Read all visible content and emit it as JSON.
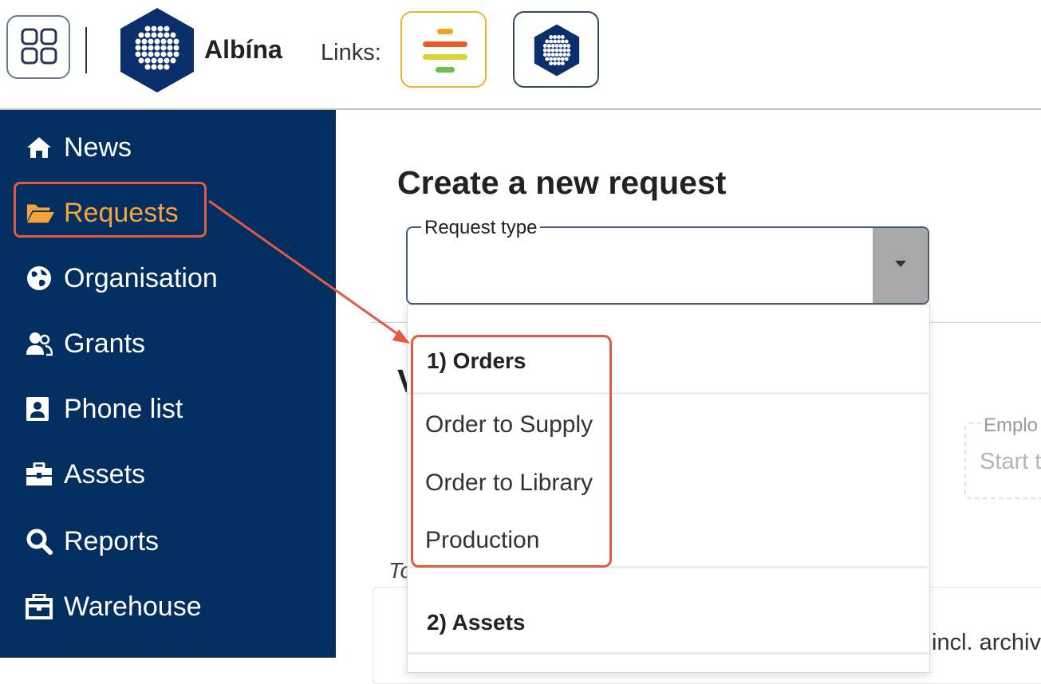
{
  "header": {
    "brand": "Albína",
    "links_label": "Links:"
  },
  "icons": {
    "apps": "apps-grid-icon",
    "logo": "albina-hexagon-logo-icon",
    "link1": "colored-bars-icon",
    "link2": "hexagon-logo-icon"
  },
  "sidebar": {
    "items": [
      {
        "label": "News",
        "icon": "home-icon"
      },
      {
        "label": "Requests",
        "icon": "folder-open-icon"
      },
      {
        "label": "Organisation",
        "icon": "globe-icon"
      },
      {
        "label": "Grants",
        "icon": "users-icon"
      },
      {
        "label": "Phone list",
        "icon": "contact-card-icon"
      },
      {
        "label": "Assets",
        "icon": "toolbox-icon"
      },
      {
        "label": "Reports",
        "icon": "search-icon"
      },
      {
        "label": "Warehouse",
        "icon": "warehouse-icon"
      }
    ],
    "active_index": 1
  },
  "main": {
    "title": "Create a new request",
    "request_type_label": "Request type",
    "request_type_value": "",
    "bg_heading_fragment": "V",
    "employee_label": "Emplo",
    "employee_placeholder": "Start t",
    "bg_to_fragment": "To",
    "bg_incl_fragment": "incl. archiv"
  },
  "dropdown": {
    "groups": [
      {
        "label": "1) Orders",
        "options": [
          "Order to Supply",
          "Order to Library",
          "Production"
        ]
      },
      {
        "label": "2) Assets",
        "options": []
      }
    ]
  },
  "colors": {
    "sidebar_bg": "#032e60",
    "active": "#f4a43a",
    "annotation": "#e25a44"
  }
}
